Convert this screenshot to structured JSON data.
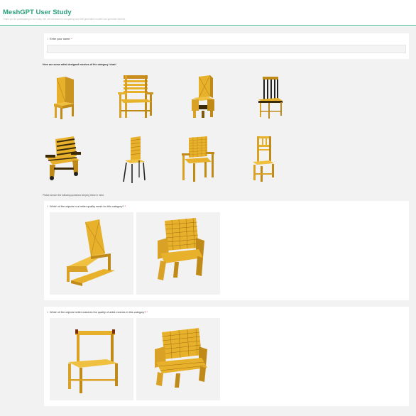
{
  "header": {
    "title": "MeshGPT User Study",
    "subtitle": "Thank you for participating in our study. We are interested in comparing how well generative models can generate meshes."
  },
  "name_question": {
    "number": "1",
    "label": "Enter your name:",
    "required_mark": "*",
    "value": "",
    "placeholder": ""
  },
  "artist_section": {
    "label": "Here are some artist designed meshes of the category 'chair'.",
    "items": [
      {
        "icon": "chair-solid-slab-icon"
      },
      {
        "icon": "chair-slatted-armchair-icon"
      },
      {
        "icon": "chair-box-armchair-icon"
      },
      {
        "icon": "chair-dark-spindle-back-icon"
      },
      {
        "icon": "chair-dark-lounge-icon"
      },
      {
        "icon": "chair-dark-legged-slat-icon"
      },
      {
        "icon": "chair-woven-armchair-icon"
      },
      {
        "icon": "chair-spindle-back-icon"
      }
    ]
  },
  "instructions": "Please answer the following questions keeping these in mind.",
  "question_quality": {
    "number": "2",
    "label": "Which of the objects is a better quality mesh for this category?",
    "required_mark": "*",
    "options": [
      {
        "icon": "chair-cantilever-icon"
      },
      {
        "icon": "chair-textured-armchair-icon"
      }
    ]
  },
  "question_match": {
    "number": "3",
    "label": "Which of the objects better matches the quality of artist meshes in this category?",
    "required_mark": "*",
    "options": [
      {
        "icon": "chair-simple-wooden-icon"
      },
      {
        "icon": "chair-textured-lounge-icon"
      }
    ]
  },
  "colors": {
    "accent": "#2aa07c",
    "chair_yellow": "#e8b12c",
    "chair_shadow": "#b98314",
    "background": "#f2f2f2"
  }
}
